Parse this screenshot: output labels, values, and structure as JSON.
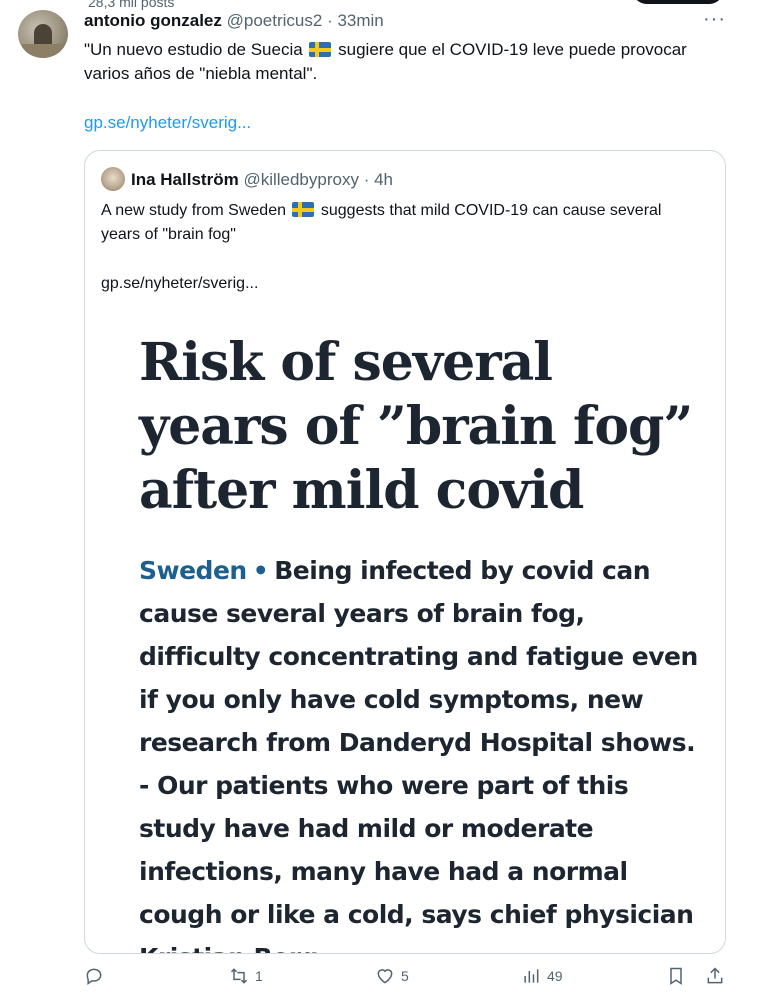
{
  "profile": {
    "posts_count": "28,3 mil posts"
  },
  "tweet": {
    "author_name": "antonio gonzalez",
    "author_handle": "@poetricus2",
    "time": "· 33min",
    "text_before_flag": "\"Un nuevo estudio de Suecia ",
    "text_after_flag": " sugiere que el COVID-19 leve puede provocar varios años de \"niebla mental\".",
    "link": "gp.se/nyheter/sverig..."
  },
  "quoted": {
    "author_name": "Ina Hallström",
    "author_handle": "@killedbyproxy",
    "time": "· 4h",
    "text_before_flag": "A new study from Sweden ",
    "text_after_flag": " suggests that mild COVID-19 can cause several years of \"brain fog\"",
    "link": "gp.se/nyheter/sverig...",
    "article": {
      "headline": "Risk of several years of ”brain fog” after mild covid",
      "kicker": "Sweden",
      "bullet": "•",
      "body": "Being infected by covid can cause several years of brain fog, difficulty concentrating and fatigue even if you only have cold symptoms, new research from Danderyd Hospital shows.",
      "quote": "- Our patients who were part of this study have had mild or moderate infections, many have had a normal cough or like a cold, says chief physician Kristian Borg."
    }
  },
  "actions": {
    "replies": "",
    "reposts": "1",
    "likes": "5",
    "views": "49"
  },
  "colors": {
    "link": "#1d9bf0",
    "muted": "#536471",
    "kicker": "#1d5f8f",
    "text": "#0f1419"
  },
  "icons": [
    "more-icon",
    "reply-icon",
    "repost-icon",
    "like-icon",
    "views-icon",
    "bookmark-icon",
    "share-icon",
    "flag-sweden-icon"
  ]
}
